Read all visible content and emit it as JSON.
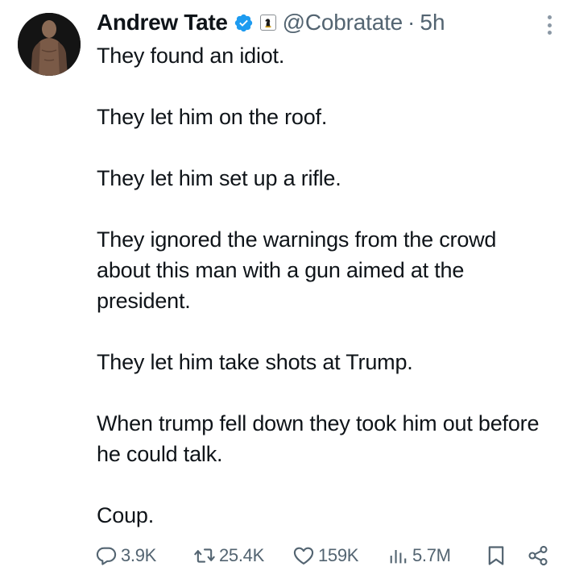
{
  "author": {
    "name": "Andrew Tate",
    "handle": "@Cobratate",
    "separator": "·",
    "time": "5h",
    "verified_color": "#1d9bf0"
  },
  "tweet": {
    "paragraphs": [
      "They found an idiot.",
      "They let him on the roof.",
      "They let him set up a rifle.",
      "They ignored the warnings from the crowd about this man with a gun aimed at the president.",
      "They let him take shots at Trump.",
      "When trump fell down they took him out before he could talk.",
      "Coup."
    ]
  },
  "stats": {
    "replies": "3.9K",
    "retweets": "25.4K",
    "likes": "159K",
    "views": "5.7M"
  },
  "icons": {
    "reply": "reply-icon",
    "retweet": "retweet-icon",
    "like": "heart-icon",
    "views": "views-icon",
    "bookmark": "bookmark-icon",
    "share": "share-icon",
    "more": "more-icon",
    "verified": "verified-badge-icon",
    "affiliate": "chess-knight-icon"
  },
  "colors": {
    "text": "#0f1419",
    "muted": "#536471"
  }
}
